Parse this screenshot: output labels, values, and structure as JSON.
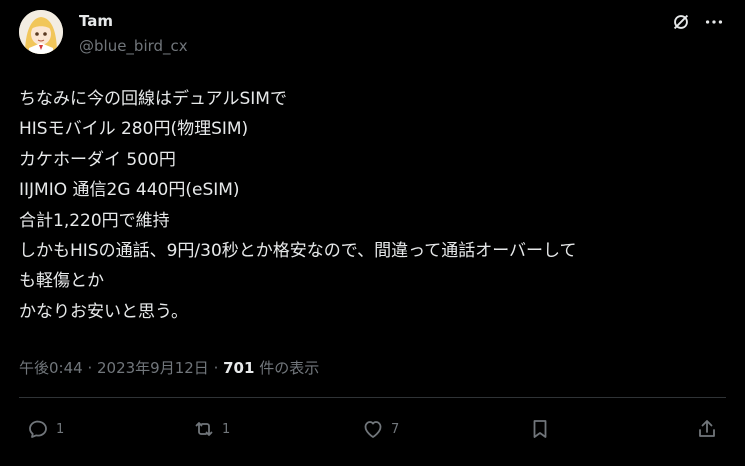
{
  "author": {
    "name": "Tam",
    "handle": "@blue_bird_cx",
    "avatar_icon": "anime-character-avatar"
  },
  "tweet": {
    "lines": [
      "ちなみに今の回線はデュアルSIMで",
      "HISモバイル 280円(物理SIM)",
      "カケホーダイ 500円",
      "IIJMIO 通信2G 440円(eSIM)",
      "合計1,220円で維持",
      "しかもHISの通話、9円/30秒とか格安なので、間違って通話オーバーして",
      "も軽傷とか",
      "かなりお安いと思う。"
    ]
  },
  "meta": {
    "time": "午後0:44",
    "sep1": " · ",
    "date": "2023年9月12日",
    "sep2": " · ",
    "views": "701",
    "views_label": " 件の表示"
  },
  "actions": {
    "reply": {
      "icon": "reply-icon",
      "count": "1"
    },
    "retweet": {
      "icon": "retweet-icon",
      "count": "1"
    },
    "like": {
      "icon": "heart-icon",
      "count": "7"
    },
    "bookmark": {
      "icon": "bookmark-icon"
    },
    "share": {
      "icon": "share-icon"
    }
  },
  "top_icons": [
    "grok-icon",
    "more-icon"
  ],
  "colors": {
    "background": "#000000",
    "text": "#e7e9ea",
    "secondary": "#71767b",
    "divider": "#2f3336"
  }
}
